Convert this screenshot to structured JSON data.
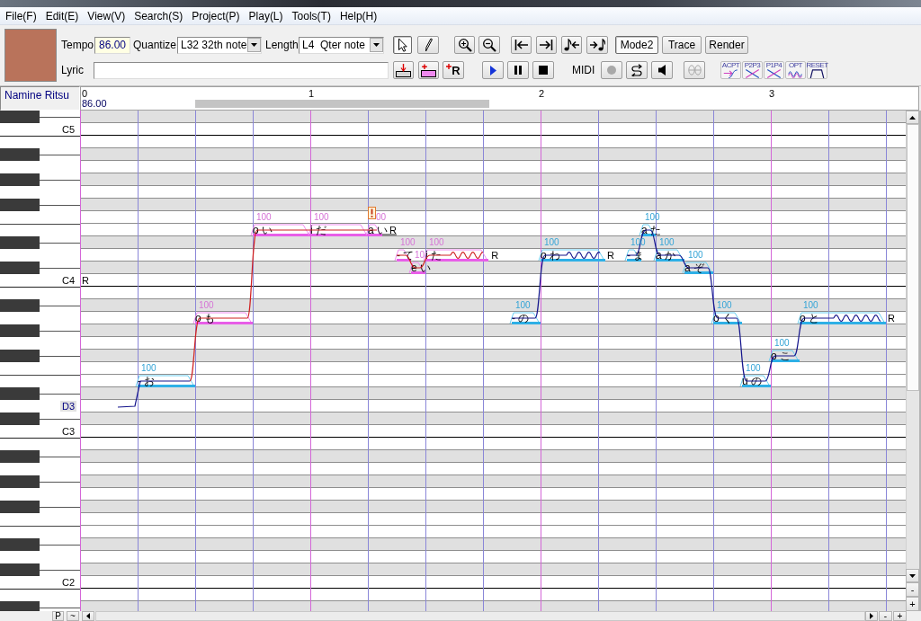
{
  "menu": [
    "File(F)",
    "Edit(E)",
    "View(V)",
    "Search(S)",
    "Project(P)",
    "Play(L)",
    "Tools(T)",
    "Help(H)"
  ],
  "toolbar": {
    "tempo_label": "Tempo",
    "tempo": "86.00",
    "quantize_label": "Quantize",
    "quantize": "L32 32th note",
    "length_label": "Length",
    "length": "L4  Qter note",
    "edit_tools": [
      {
        "kind": "pointer",
        "selected": true
      },
      {
        "kind": "pencil",
        "selected": false
      }
    ],
    "modes": [
      {
        "label": "Mode2",
        "selected": true
      },
      {
        "label": "Trace",
        "selected": false
      },
      {
        "label": "Render",
        "selected": false
      }
    ],
    "lyric_label": "Lyric",
    "rest_button": "R",
    "transport": [
      {
        "kind": "play",
        "disabled": false
      },
      {
        "kind": "pause",
        "disabled": false
      },
      {
        "kind": "stop",
        "disabled": false
      }
    ],
    "midi_label": "MIDI",
    "midi_buttons": [
      {
        "kind": "record",
        "disabled": true
      },
      {
        "kind": "loop",
        "disabled": false
      },
      {
        "kind": "speaker",
        "disabled": false
      },
      {
        "kind": "link",
        "disabled": true
      }
    ],
    "pitch_tools": [
      {
        "label": "ACPT",
        "kind": "accept"
      },
      {
        "label": "P2P3",
        "kind": "cross"
      },
      {
        "label": "P1P4",
        "kind": "cross"
      },
      {
        "label": "OPT",
        "kind": "wave"
      },
      {
        "label": "RESET",
        "kind": "reset"
      }
    ]
  },
  "track": {
    "singer": "Namine Ritsu"
  },
  "ruler": {
    "measures": [
      "0",
      "1",
      "2",
      "3"
    ],
    "tempo": "86.00"
  },
  "keyboard": {
    "labels": [
      {
        "text": "C5",
        "highlighted": false
      },
      {
        "text": "C4",
        "highlighted": false
      },
      {
        "text": "D3",
        "highlighted": true
      },
      {
        "text": "C3",
        "highlighted": false
      },
      {
        "text": "C2",
        "highlighted": false
      }
    ]
  },
  "notes": [
    {
      "lyric": "- お",
      "velocity": "100",
      "selected": false,
      "vibrato": false,
      "warning": false
    },
    {
      "lyric": "o も",
      "velocity": "100",
      "selected": true,
      "vibrato": false,
      "warning": false
    },
    {
      "lyric": "o い",
      "velocity": "100",
      "selected": true,
      "vibrato": false,
      "warning": false
    },
    {
      "lyric": "i だ",
      "velocity": "100",
      "selected": true,
      "vibrato": false,
      "warning": false
    },
    {
      "lyric": "a い",
      "velocity": "00",
      "selected": true,
      "vibrato": false,
      "warning": true
    },
    {
      "lyric": "- て",
      "velocity": "100",
      "selected": true,
      "vibrato": false,
      "warning": false
    },
    {
      "lyric": "e い",
      "velocity": "10",
      "selected": true,
      "vibrato": false,
      "warning": false
    },
    {
      "lyric": "i た",
      "velocity": "100",
      "selected": true,
      "vibrato": true,
      "warning": false
    },
    {
      "lyric": "- の",
      "velocity": "100",
      "selected": false,
      "vibrato": false,
      "warning": false
    },
    {
      "lyric": "o わ",
      "velocity": "100",
      "selected": false,
      "vibrato": true,
      "warning": false
    },
    {
      "lyric": "- ま",
      "velocity": "100",
      "selected": false,
      "vibrato": false,
      "warning": false
    },
    {
      "lyric": "a た",
      "velocity": "100",
      "selected": false,
      "vibrato": false,
      "warning": false
    },
    {
      "lyric": "a か",
      "velocity": "100",
      "selected": false,
      "vibrato": false,
      "warning": false
    },
    {
      "lyric": "a ぞ",
      "velocity": "100",
      "selected": false,
      "vibrato": false,
      "warning": false
    },
    {
      "lyric": "o く",
      "velocity": "100",
      "selected": false,
      "vibrato": false,
      "warning": false
    },
    {
      "lyric": "u の",
      "velocity": "100",
      "selected": false,
      "vibrato": false,
      "warning": false
    },
    {
      "lyric": "o こ",
      "velocity": "100",
      "selected": false,
      "vibrato": false,
      "warning": false
    },
    {
      "lyric": "o と",
      "velocity": "100",
      "selected": false,
      "vibrato": true,
      "warning": false
    }
  ],
  "rests": [
    {
      "label": "R"
    },
    {
      "label": "R"
    },
    {
      "label": "R"
    },
    {
      "label": "R"
    },
    {
      "label": "R"
    }
  ],
  "bottom_bar": {
    "buttons": [
      "P",
      "~"
    ],
    "zoom": [
      "-",
      "+"
    ]
  },
  "vertical_scrollbar": {
    "zoom": [
      "-",
      "+"
    ]
  }
}
